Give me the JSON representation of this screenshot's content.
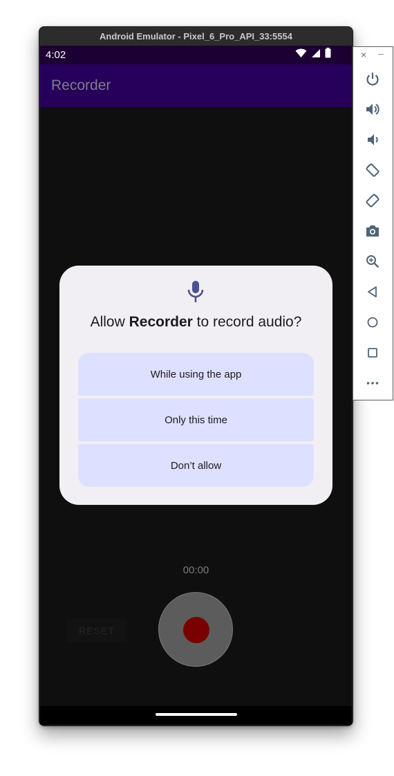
{
  "emulator": {
    "window_title": "Android Emulator - Pixel_6_Pro_API_33:5554"
  },
  "status_bar": {
    "time": "4:02",
    "icons": [
      "wifi-icon",
      "signal-icon",
      "battery-icon"
    ]
  },
  "app_bar": {
    "title": "Recorder"
  },
  "recorder": {
    "timer": "00:00",
    "reset_label": "RESET",
    "record_color": "#7a0000"
  },
  "permission_dialog": {
    "icon": "microphone-icon",
    "title_prefix": "Allow ",
    "title_app": "Recorder",
    "title_suffix": " to record audio?",
    "options": [
      {
        "label": "While using the app"
      },
      {
        "label": "Only this time"
      },
      {
        "label": "Don’t allow"
      }
    ]
  },
  "side_toolbar": {
    "close_glyph": "×",
    "minimize_glyph": "–",
    "buttons": [
      "power-icon",
      "volume-up-icon",
      "volume-down-icon",
      "rotate-left-icon",
      "rotate-right-icon",
      "camera-icon",
      "zoom-icon",
      "back-icon",
      "home-icon",
      "overview-icon",
      "more-icon"
    ]
  },
  "colors": {
    "status_bar": "#1d0033",
    "app_bar": "#26005a",
    "dialog_bg": "#f2eff4",
    "option_bg": "#dee0ff",
    "toolbar_icon": "#4f6478"
  }
}
